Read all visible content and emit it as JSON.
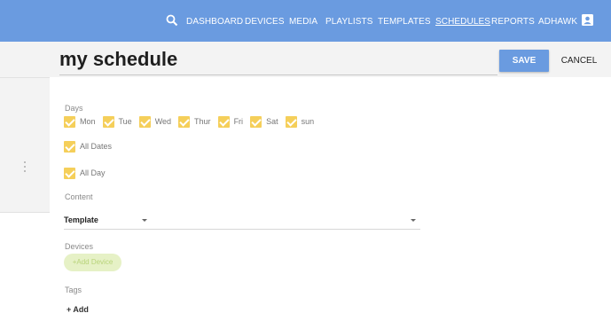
{
  "nav": {
    "items": [
      "DASHBOARD",
      "DEVICES",
      "MEDIA",
      "PLAYLISTS",
      "TEMPLATES",
      "SCHEDULES",
      "REPORTS",
      "ADHAWK"
    ],
    "active": "SCHEDULES",
    "search_icon": "search-icon",
    "user_icon": "account-box-icon"
  },
  "header": {
    "title": "my schedule",
    "save_label": "SAVE",
    "cancel_label": "CANCEL"
  },
  "form": {
    "days_label": "Days",
    "days": [
      "Mon",
      "Tue",
      "Wed",
      "Thur",
      "Fri",
      "Sat",
      "sun"
    ],
    "all_dates_label": "All Dates",
    "all_day_label": "All Day",
    "content_label": "Content",
    "content_select_value": "Template",
    "devices_label": "Devices",
    "add_device_label": "+Add Device",
    "tags_label": "Tags",
    "add_tag_label": "+ Add"
  },
  "colors": {
    "nav_bg": "#6a9be0",
    "checkbox": "#f5cf5a",
    "add_device_bg": "#e6f1c6"
  }
}
